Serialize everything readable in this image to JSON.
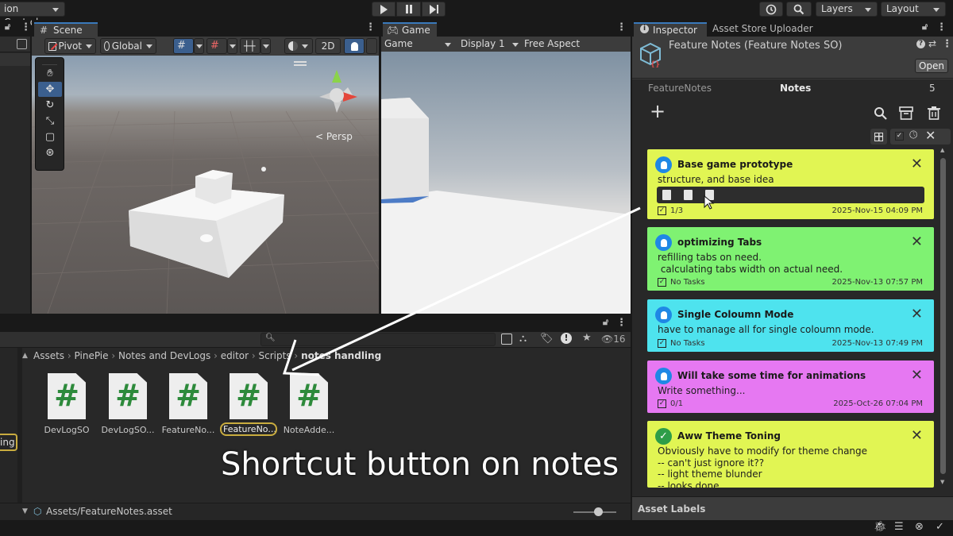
{
  "topbar": {
    "version_control": "ion Control"
  },
  "scene": {
    "tab": "Scene",
    "pivot": "Pivot",
    "global": "Global",
    "mode_2d": "2D",
    "persp": "< Persp"
  },
  "game": {
    "tab": "Game",
    "mode": "Game",
    "display": "Display 1",
    "aspect": "Free Aspect"
  },
  "top_right": {
    "layers": "Layers",
    "layout": "Layout"
  },
  "project": {
    "breadcrumbs": [
      "Assets",
      "PinePie",
      "Notes and DevLogs",
      "editor",
      "Scripts",
      "notes handling"
    ],
    "count": "16",
    "files": [
      "DevLogSO",
      "DevLogSO...",
      "FeatureNo...",
      "FeatureNo...",
      "NoteAdde..."
    ],
    "status_path": "Assets/FeatureNotes.asset",
    "left_label": "ing"
  },
  "overlay_caption": "Shortcut button on notes",
  "inspector": {
    "tab": "Inspector",
    "tab2": "Asset Store Uploader",
    "object_title": "Feature Notes (Feature Notes SO)",
    "open_button": "Open",
    "header_left": "FeatureNotes",
    "header_center": "Notes",
    "header_count": "5",
    "asset_labels": "Asset Labels"
  },
  "notes": [
    {
      "title": "Base game prototype",
      "body": "structure, and base idea",
      "tasks": "1/3",
      "date": "2025-Nov-15 04:09 PM",
      "color": "#e1f553",
      "icon": "info-bulb-icon"
    },
    {
      "title": "optimizing Tabs",
      "body": "refilling tabs on need.\n calculating tabs width on actual need.",
      "tasks": "No Tasks",
      "date": "2025-Nov-13 07:57 PM",
      "color": "#7ff272",
      "icon": "info-bulb-icon"
    },
    {
      "title": "Single Coloumn Mode",
      "body": "have to manage all for single coloumn mode.",
      "tasks": "No Tasks",
      "date": "2025-Nov-13 07:49 PM",
      "color": "#4ee3ee",
      "icon": "info-bulb-icon"
    },
    {
      "title": "Will take some time for animations",
      "body": "Write something...",
      "tasks": "0/1",
      "date": "2025-Oct-26 07:04 PM",
      "color": "#e678f2",
      "icon": "info-bulb-icon"
    },
    {
      "title": "Aww Theme Toning",
      "body": "Obviously have to modify for theme change\n-- can't just ignore it??\n-- light theme blunder\n-- looks done",
      "tasks": "",
      "date": "",
      "color": "#e1f553",
      "icon": "check-circle-icon"
    }
  ]
}
